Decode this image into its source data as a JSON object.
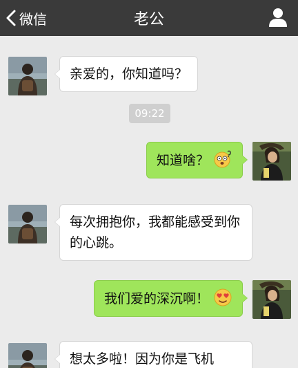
{
  "header": {
    "back_label": "微信",
    "title": "老公"
  },
  "timestamp": "09:22",
  "messages": [
    {
      "side": "left",
      "text": "亲爱的，你知道吗？"
    },
    {
      "side": "right",
      "text": "知道啥？",
      "emoji": "dizzy-face-emoji"
    },
    {
      "side": "left",
      "text": "每次拥抱你，我都能感受到你的心跳。"
    },
    {
      "side": "right",
      "text": "我们爱的深沉啊！",
      "emoji": "heart-eyes-emoji"
    },
    {
      "side": "left",
      "text": "想太多啦！因为你是飞机"
    }
  ],
  "colors": {
    "header_bg": "#3a3a3a",
    "chat_bg": "#ebebeb",
    "left_bubble": "#ffffff",
    "right_bubble": "#9fe55b"
  }
}
